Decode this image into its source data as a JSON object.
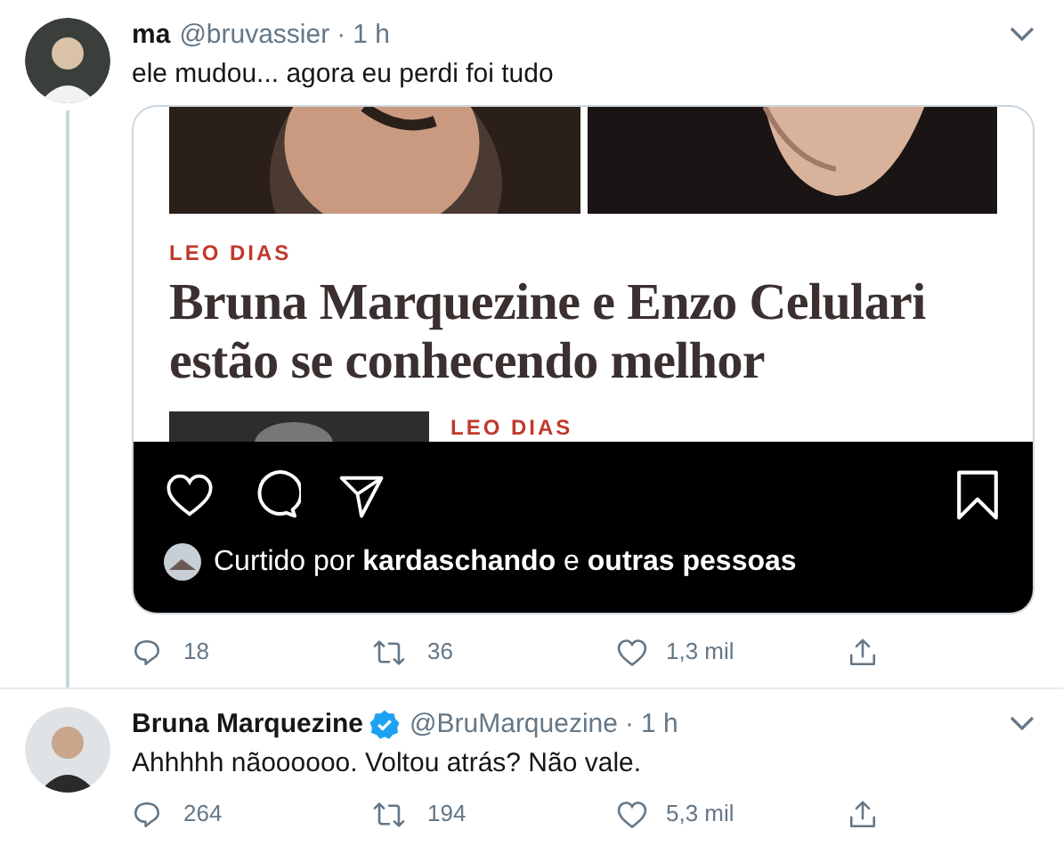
{
  "tweets": [
    {
      "name": "ma",
      "verified": false,
      "handle": "@bruvassier",
      "separator": "·",
      "time": "1 h",
      "text": "ele mudou... agora eu perdi foi tudo",
      "thread_line": true,
      "media": {
        "source": "LEO DIAS",
        "headline": "Bruna Marquezine e Enzo Celulari estão se conhecendo melhor",
        "next_source": "LEO DIAS",
        "liked_prefix": "Curtido por",
        "liked_user": "kardaschando",
        "liked_joiner": "e",
        "liked_rest": "outras pessoas"
      },
      "actions": {
        "replies": "18",
        "retweets": "36",
        "likes": "1,3 mil"
      }
    },
    {
      "name": "Bruna Marquezine",
      "verified": true,
      "handle": "@BruMarquezine",
      "separator": "·",
      "time": "1 h",
      "text": "Ahhhhh nãoooooo. Voltou atrás? Não vale.",
      "thread_line": false,
      "actions": {
        "replies": "264",
        "retweets": "194",
        "likes": "5,3 mil"
      }
    }
  ]
}
